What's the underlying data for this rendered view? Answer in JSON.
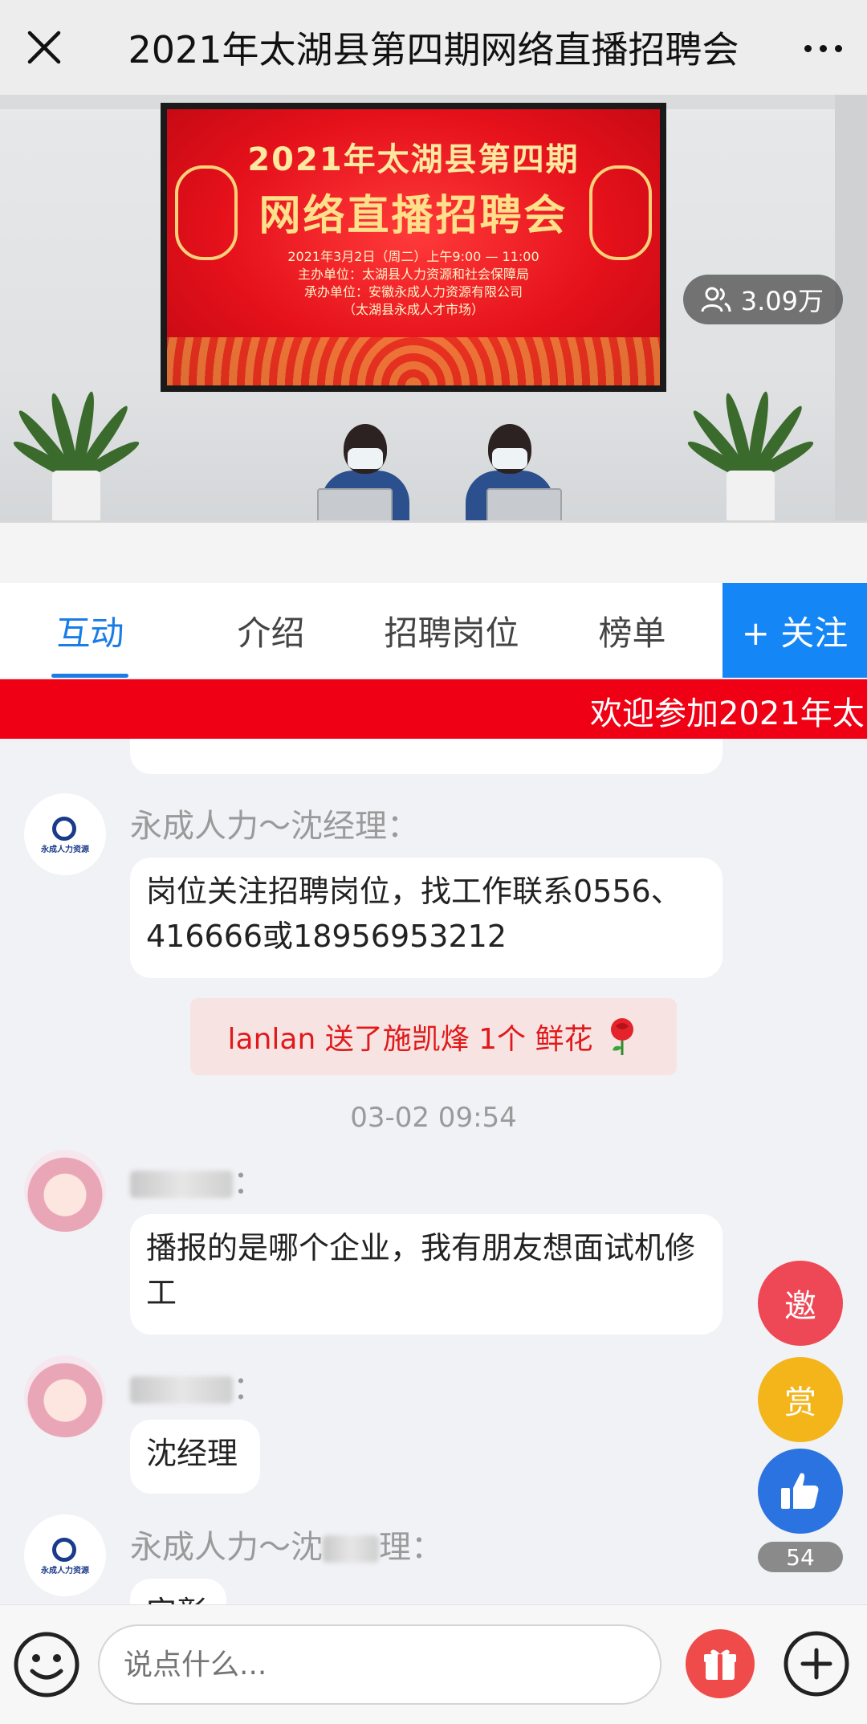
{
  "header": {
    "title": "2021年太湖县第四期网络直播招聘会"
  },
  "video": {
    "screen_title_line1": "2021年太湖县第四期",
    "screen_title_line2": "网络直播招聘会",
    "screen_date": "2021年3月2日（周二）上午9:00 — 11:00",
    "screen_host": "主办单位：太湖县人力资源和社会保障局",
    "screen_organizer": "承办单位：安徽永成人力资源有限公司",
    "screen_market": "（太湖县永成人才市场）",
    "viewer_count": "3.09万"
  },
  "tabs": [
    {
      "label": "互动",
      "active": true
    },
    {
      "label": "介绍"
    },
    {
      "label": "招聘岗位"
    },
    {
      "label": "榜单"
    }
  ],
  "follow_label": "+ 关注",
  "marquee_text": "欢迎参加2021年太",
  "chat": {
    "messages": [
      {
        "sender": "永成人力～沈经理：",
        "text": "岗位关注招聘岗位，找工作联系0556、416666或18956953212"
      },
      {
        "sender_suffix": "：",
        "text": "播报的是哪个企业，我有朋友想面试机修工"
      },
      {
        "sender_suffix": "：",
        "text": "沈经理"
      },
      {
        "sender_prefix": "永成人力～沈",
        "sender_suffix": "理：",
        "text": "实彰"
      }
    ],
    "gift_notice": "lanlan 送了施凯烽 1个 鲜花",
    "timestamp": "03-02 09:54"
  },
  "floating": {
    "invite_label": "邀",
    "reward_label": "赏",
    "like_count": "54"
  },
  "composer": {
    "placeholder": "说点什么..."
  },
  "colors": {
    "accent": "#1486f6",
    "marquee": "#f00014",
    "gift_text": "#e1191b"
  }
}
